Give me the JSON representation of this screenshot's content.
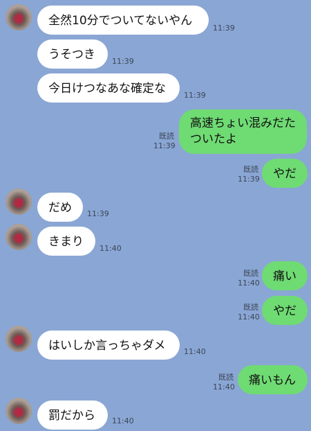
{
  "messages": [
    {
      "side": "in",
      "text": "全然10分でついてないやん",
      "time": "11:39",
      "avatar": true
    },
    {
      "side": "in",
      "text": "うそつき",
      "time": "11:39"
    },
    {
      "side": "in",
      "text": "今日けつなあな確定な",
      "time": "11:39"
    },
    {
      "side": "out",
      "line1": "高速ちょい混みだた",
      "line2": "ついたよ",
      "read": "既読",
      "time": "11:39"
    },
    {
      "side": "out",
      "text": "やだ",
      "read": "既読",
      "time": "11:39"
    },
    {
      "side": "in",
      "text": "だめ",
      "time": "11:39",
      "avatar": true
    },
    {
      "side": "in",
      "text": "きまり",
      "time": "11:40",
      "avatar": true
    },
    {
      "side": "out",
      "text": "痛い",
      "read": "既読",
      "time": "11:40"
    },
    {
      "side": "out",
      "text": "やだ",
      "read": "既読",
      "time": "11:40"
    },
    {
      "side": "in",
      "text": "はいしか言っちゃダメ",
      "time": "11:40",
      "avatar": true
    },
    {
      "side": "out",
      "text": "痛いもん",
      "read": "既読",
      "time": "11:40"
    },
    {
      "side": "in",
      "text": "罰だから",
      "time": "11:40",
      "avatar": true
    }
  ],
  "colors": {
    "background": "#8aa6d4",
    "incoming": "#ffffff",
    "outgoing": "#6fdb73"
  }
}
